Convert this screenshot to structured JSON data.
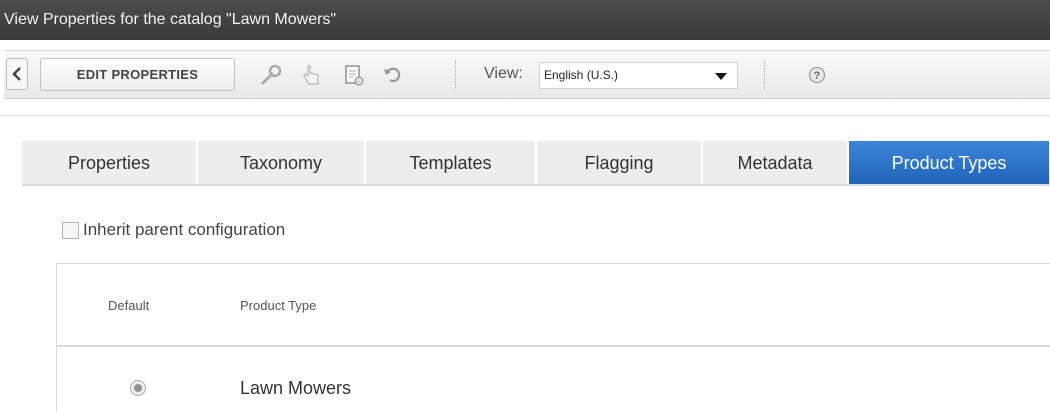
{
  "window": {
    "title": "View Properties for the catalog \"Lawn Mowers\""
  },
  "toolbar": {
    "back_icon": "chevron-left-icon",
    "edit_label": "EDIT PROPERTIES",
    "icons": [
      "wrench-icon",
      "hand-pointer-icon",
      "document-icon",
      "undo-icon",
      "help-icon"
    ],
    "view_label": "View:",
    "view_value": "English (U.S.)"
  },
  "tabs": [
    {
      "label": "Properties",
      "active": false
    },
    {
      "label": "Taxonomy",
      "active": false
    },
    {
      "label": "Templates",
      "active": false
    },
    {
      "label": "Flagging",
      "active": false
    },
    {
      "label": "Metadata",
      "active": false
    },
    {
      "label": "Product Types",
      "active": true
    }
  ],
  "inherit": {
    "label": "Inherit parent configuration",
    "checked": false
  },
  "table": {
    "columns": [
      "Default",
      "Product Type"
    ],
    "rows": [
      {
        "default": true,
        "product_type": "Lawn Mowers"
      }
    ]
  },
  "colors": {
    "active_tab": "#2a72c9",
    "titlebar": "#444444"
  }
}
